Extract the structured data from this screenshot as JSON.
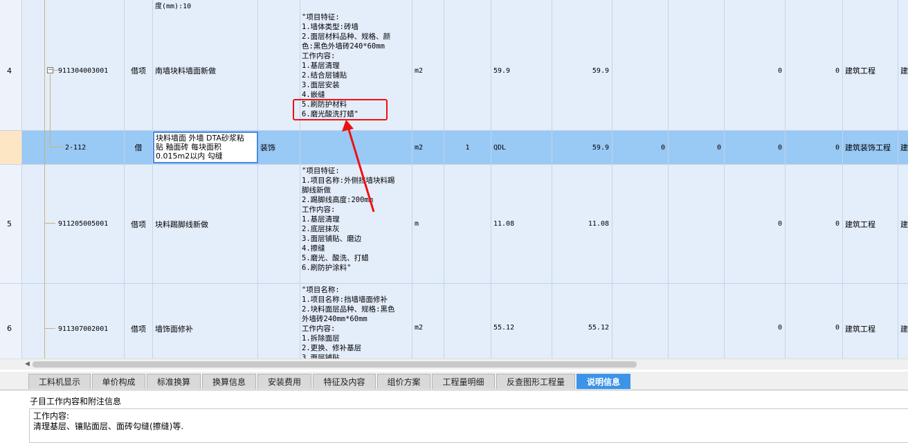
{
  "top_partial": {
    "desc": "度(mm):10"
  },
  "rows": [
    {
      "num": "4",
      "code": "911304003001",
      "type": "借项",
      "name": "南墙块料墙面新做",
      "desc": "\"项目特征:\n1.墙体类型:砖墙\n2.面层材料品种、规格、颜\n色:黑色外墙砖240*60mm\n工作内容:\n1.基层清理\n2.结合层铺贴\n3.面层安装\n4.嵌缝\n5.刷防护材料\n6.磨光酸洗打蜡\"",
      "unit": "m2",
      "qty_expr": "59.9",
      "qty": "59.9",
      "v1": "0",
      "v2": "0",
      "major": "建筑工程",
      "extra": "建"
    },
    {
      "num": "",
      "code": "2-112",
      "type": "借",
      "name": "块料墙面 外墙 DTA砂浆粘\n贴 釉面砖 每块面积\n0.015m2以内 勾缝",
      "category": "装饰",
      "unit": "m2",
      "coef": "1",
      "qty_expr": "QDL",
      "qty": "59.9",
      "v0": "0",
      "v0b": "0",
      "v1": "0",
      "v2": "0",
      "major": "建筑装饰工程",
      "extra": "建"
    },
    {
      "num": "5",
      "code": "911205005001",
      "type": "借项",
      "name": "块料踢脚线新做",
      "desc": "\"项目特征:\n1.项目名称:外侧挡墙块料踢\n脚线新做\n2.踢脚线高度:200mm\n工作内容:\n1.基层清理\n2.底层抹灰\n3.面层铺贴、磨边\n4.擦缝\n5.磨光、酸洗、打蜡\n6.刷防护涂料\"",
      "unit": "m",
      "qty_expr": "11.08",
      "qty": "11.08",
      "v1": "0",
      "v2": "0",
      "major": "建筑工程",
      "extra": "建"
    },
    {
      "num": "6",
      "code": "911307002001",
      "type": "借项",
      "name": "墙饰面修补",
      "desc": "\"项目名称:\n1.项目名称:挡墙墙面修补\n2.块料面层品种、规格:黑色\n外墙砖240mm*60mm\n工作内容:\n1.拆除面层\n2.更换、修补基层\n3.面层铺贴",
      "unit": "m2",
      "qty_expr": "55.12",
      "qty": "55.12",
      "v1": "0",
      "v2": "0",
      "major": "建筑工程",
      "extra": "建"
    }
  ],
  "tabs": [
    "工料机显示",
    "单价构成",
    "标准换算",
    "换算信息",
    "安装费用",
    "特征及内容",
    "组价方案",
    "工程量明细",
    "反查图形工程量",
    "说明信息"
  ],
  "panel": {
    "title": "子目工作内容和附注信息",
    "content_line1": "工作内容:",
    "content_line2": "清理基层、镶贴面层、面砖勾缝(擦缝)等."
  },
  "colors": {
    "row_bg": "#e4edfa",
    "selected_row": "#99c9f5",
    "active_tab": "#3c93e8",
    "annotation": "#ee1010"
  }
}
